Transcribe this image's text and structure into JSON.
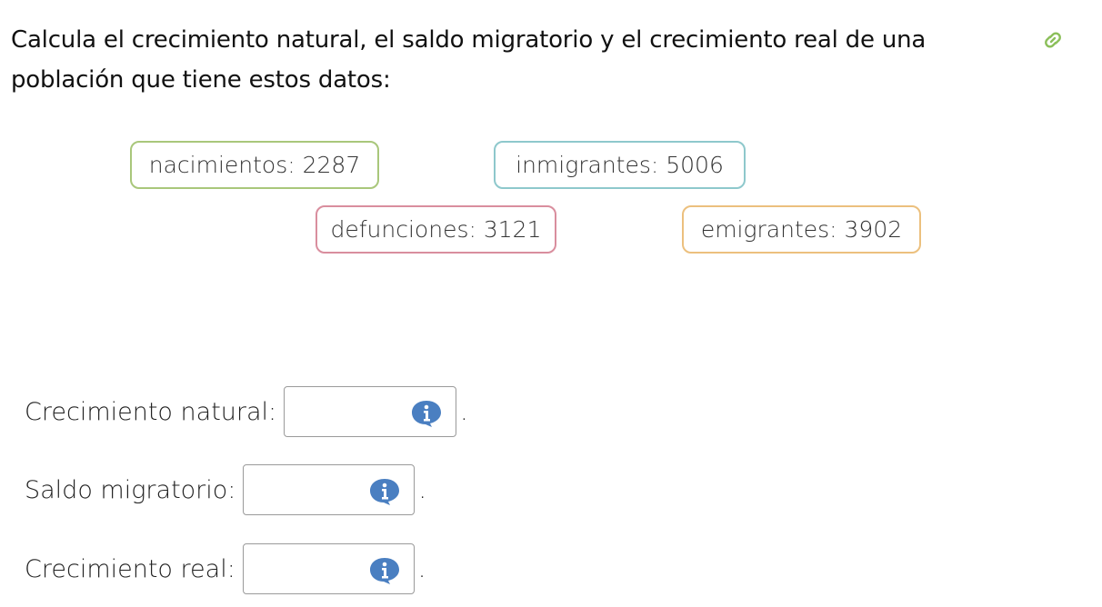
{
  "question": {
    "line1": "Calcula el crecimiento natural, el saldo migratorio y el crecimiento real de una",
    "line2": "población que tiene estos datos:"
  },
  "icons": {
    "link": "link-icon",
    "info": "info-icon"
  },
  "colors": {
    "green": "#a9c77b",
    "cyan": "#8ec8cc",
    "pink": "#d98e9e",
    "orange": "#ecc07e",
    "link": "#8bbf5a",
    "info": "#4a7fc1"
  },
  "data_tags": [
    {
      "label": "nacimientos: 2287"
    },
    {
      "label": "inmigrantes: 5006"
    },
    {
      "label": "defunciones: 3121"
    },
    {
      "label": "emigrantes: 3902"
    }
  ],
  "answers": [
    {
      "label": "Crecimiento natural:",
      "value": "",
      "suffix": "."
    },
    {
      "label": "Saldo migratorio:",
      "value": "",
      "suffix": "."
    },
    {
      "label": "Crecimiento real:",
      "value": "",
      "suffix": "."
    }
  ]
}
